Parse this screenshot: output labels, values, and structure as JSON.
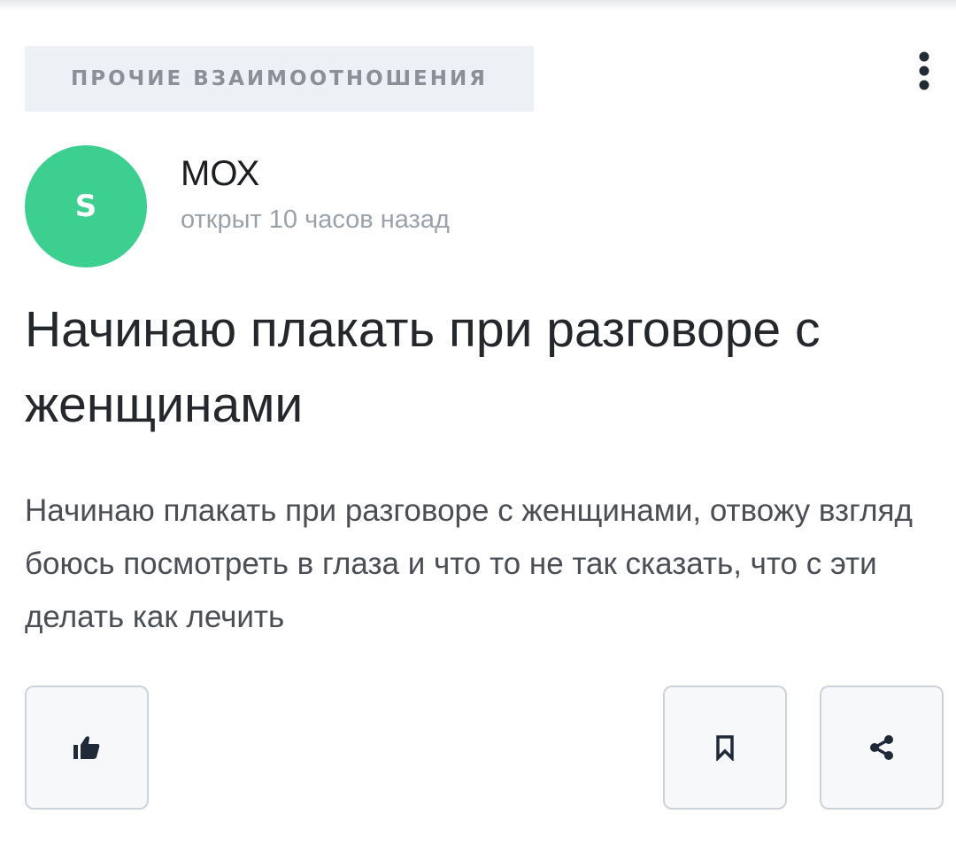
{
  "category": {
    "label": "ПРОЧИЕ ВЗАИМООТНОШЕНИЯ"
  },
  "menu": {
    "icon": "more-vertical-icon"
  },
  "author": {
    "avatar_letter": "S",
    "avatar_color": "#3ccf8f",
    "name": "МОХ",
    "meta": "открыт 10 часов назад"
  },
  "post": {
    "title": "Начинаю плакать при разговоре с женщинами",
    "body": "Начинаю плакать при разговоре с женщинами, отвожу взгляд боюсь посмотреть в глаза и что то не так сказать, что с эти делать как лечить"
  },
  "actions": {
    "like_icon": "thumbs-up-icon",
    "bookmark_icon": "bookmark-icon",
    "share_icon": "share-icon"
  },
  "colors": {
    "tag_background": "#edf0f4",
    "icon_color": "#1f2937",
    "button_border": "#cdd3da"
  }
}
